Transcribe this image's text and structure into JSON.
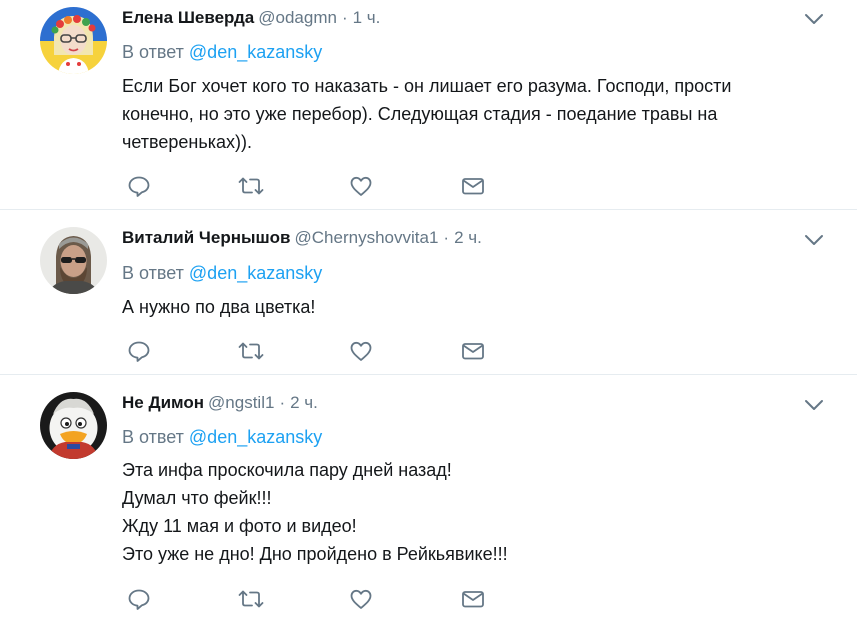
{
  "reply_prefix": "В ответ",
  "tweets": [
    {
      "name": "Елена Шеверда",
      "handle": "@odagmn",
      "dot": "·",
      "time": "1 ч.",
      "mention": "@den_kazansky",
      "lines": [
        "Если Бог хочет кого то наказать - он лишает его разума. Господи, прости",
        "конечно, но это уже перебор). Следующая стадия - поедание травы на",
        "четвереньках))."
      ]
    },
    {
      "name": "Виталий Чернышов",
      "handle": "@Chernyshovvita1",
      "dot": "·",
      "time": "2 ч.",
      "mention": "@den_kazansky",
      "lines": [
        "А нужно по два цветка!"
      ]
    },
    {
      "name": "Не Димон",
      "handle": "@ngstil1",
      "dot": "·",
      "time": "2 ч.",
      "mention": "@den_kazansky",
      "lines": [
        "Эта инфа проскочила пару дней назад!",
        "Думал что фейк!!!",
        "Жду 11 мая и фото и видео!",
        "Это уже не дно! Дно пройдено в Рейкьявике!!!"
      ]
    }
  ],
  "icons": {
    "reply": "reply-icon",
    "retweet": "retweet-icon",
    "like": "like-icon",
    "dm": "direct-message-icon",
    "more": "chevron-down-icon"
  },
  "colors": {
    "text": "#14171a",
    "secondary": "#657786",
    "link": "#1da1f2",
    "icon": "#657786",
    "divider": "#e6ecf0"
  }
}
